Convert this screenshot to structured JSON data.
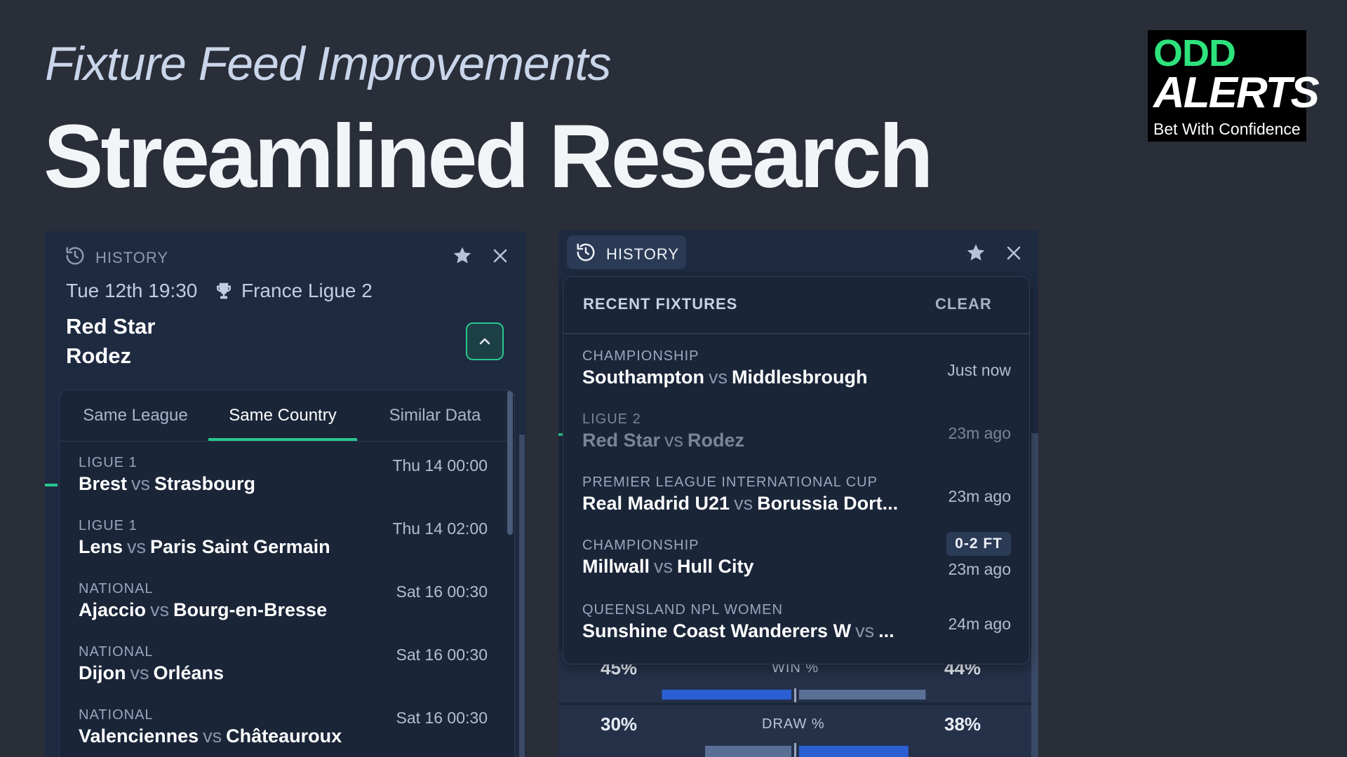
{
  "hero": {
    "subtitle": "Fixture Feed Improvements",
    "title": "Streamlined Research"
  },
  "logo": {
    "line1": "ODD",
    "line2": "ALERTS",
    "tagline": "Bet With Confidence"
  },
  "left_panel": {
    "history_label": "HISTORY",
    "fixture_time": "Tue 12th 19:30",
    "competition": "France Ligue 2",
    "home_team": "Red Star",
    "away_team": "Rodez",
    "tabs": [
      "Same League",
      "Same Country",
      "Similar Data"
    ],
    "active_tab": 1,
    "vs": "vs",
    "fixtures": [
      {
        "league": "LIGUE 1",
        "home": "Brest",
        "away": "Strasbourg",
        "time": "Thu 14 00:00"
      },
      {
        "league": "LIGUE 1",
        "home": "Lens",
        "away": "Paris Saint Germain",
        "time": "Thu 14 02:00"
      },
      {
        "league": "NATIONAL",
        "home": "Ajaccio",
        "away": "Bourg-en-Bresse",
        "time": "Sat 16 00:30"
      },
      {
        "league": "NATIONAL",
        "home": "Dijon",
        "away": "Orléans",
        "time": "Sat 16 00:30"
      },
      {
        "league": "NATIONAL",
        "home": "Valenciennes",
        "away": "Châteauroux",
        "time": "Sat 16 00:30"
      }
    ]
  },
  "right_panel": {
    "history_label": "HISTORY",
    "dropdown_title": "RECENT FIXTURES",
    "clear_label": "CLEAR",
    "vs": "vs",
    "recent": [
      {
        "league": "CHAMPIONSHIP",
        "home": "Southampton",
        "away": "Middlesbrough",
        "ago": "Just now"
      },
      {
        "league": "LIGUE 2",
        "home": "Red Star",
        "away": "Rodez",
        "ago": "23m ago"
      },
      {
        "league": "PREMIER LEAGUE INTERNATIONAL CUP",
        "home": "Real Madrid U21",
        "away": "Borussia Dort...",
        "ago": "23m ago"
      },
      {
        "league": "CHAMPIONSHIP",
        "home": "Millwall",
        "away": "Hull City",
        "ago": "23m ago",
        "score": "0-2 FT"
      },
      {
        "league": "QUEENSLAND NPL WOMEN",
        "home": "Sunshine Coast Wanderers W",
        "away": "...",
        "ago": "24m ago"
      }
    ],
    "stats": [
      {
        "label": "WIN %",
        "home": "45%",
        "away": "44%",
        "home_value": 45,
        "away_value": 44
      },
      {
        "label": "DRAW %",
        "home": "30%",
        "away": "38%",
        "home_value": 30,
        "away_value": 38
      }
    ]
  },
  "colors": {
    "accent": "#28c78e",
    "panel": "#1e2a40",
    "background": "#2a2e38",
    "bar_home": "#2c5fd3",
    "bar_away": "#5a6f95"
  }
}
